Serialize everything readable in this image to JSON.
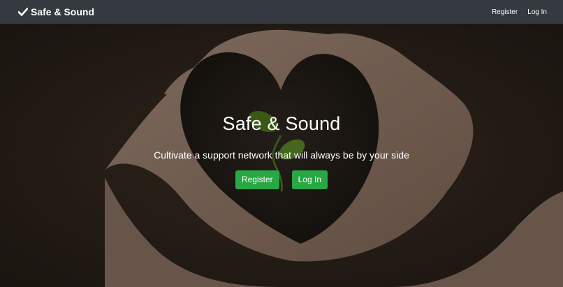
{
  "navbar": {
    "brand": "Safe & Sound",
    "links": [
      "Register",
      "Log In"
    ]
  },
  "hero": {
    "title": "Safe & Sound",
    "subtitle": "Cultivate a support network that will always be by your side",
    "buttons": [
      "Register",
      "Log In"
    ]
  },
  "colors": {
    "navbar_bg": "#343a40",
    "button_bg": "#28a745",
    "text": "#ffffff"
  },
  "icons": {
    "brand_icon": "checkmark-icon"
  }
}
